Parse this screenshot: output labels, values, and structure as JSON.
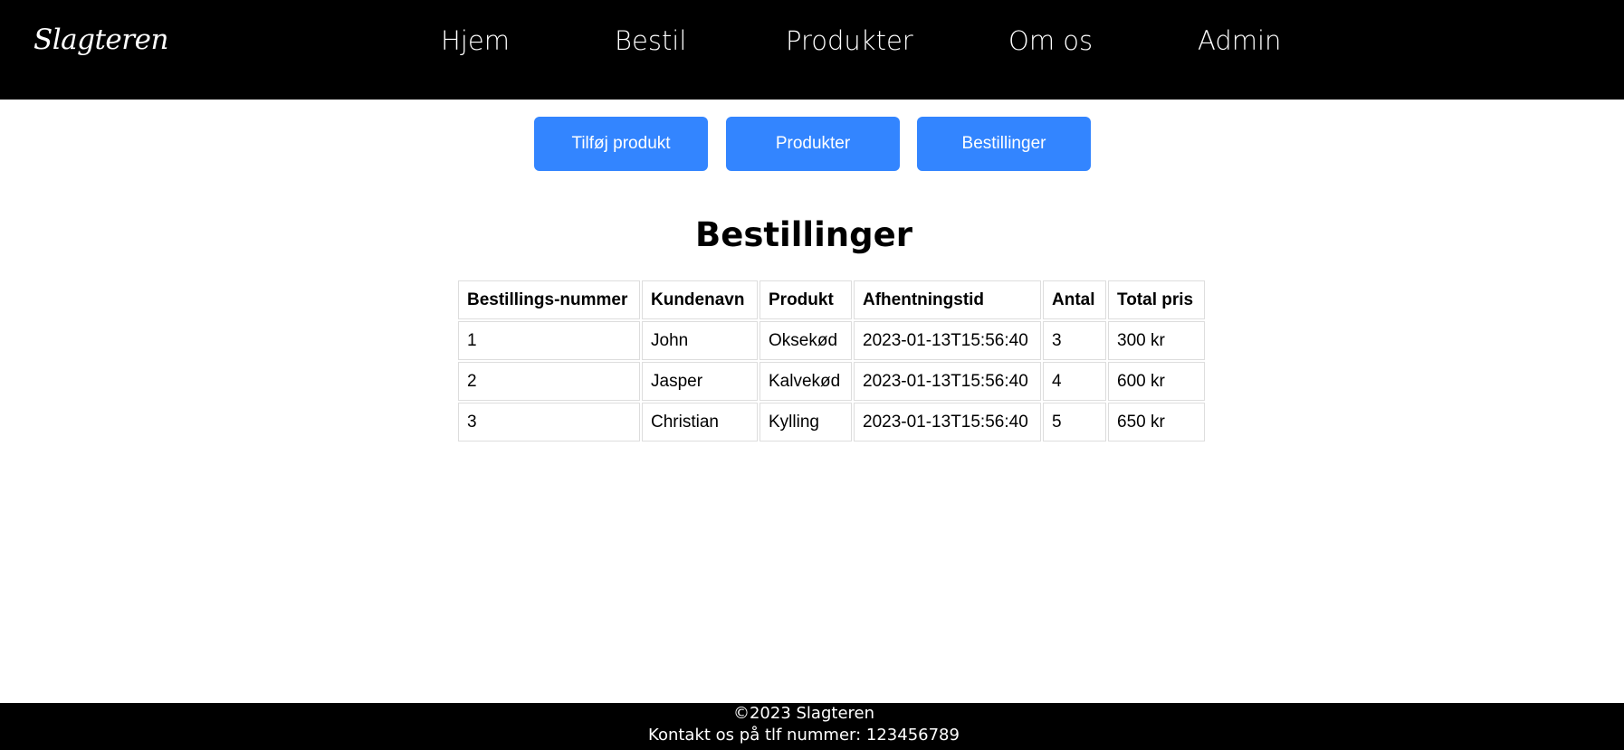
{
  "header": {
    "logo": "Slagteren",
    "nav": [
      {
        "id": "hjem",
        "label": "Hjem"
      },
      {
        "id": "bestil",
        "label": "Bestil"
      },
      {
        "id": "produkter",
        "label": "Produkter"
      },
      {
        "id": "omos",
        "label": "Om os"
      },
      {
        "id": "admin",
        "label": "Admin"
      }
    ]
  },
  "admin_buttons": {
    "add_product": "Tilføj produkt",
    "products": "Produkter",
    "orders": "Bestillinger"
  },
  "orders": {
    "title": "Bestillinger",
    "columns": [
      "Bestillings-nummer",
      "Kundenavn",
      "Produkt",
      "Afhentningstid",
      "Antal",
      "Total pris"
    ],
    "rows": [
      [
        "1",
        "John",
        "Oksekød",
        "2023-01-13T15:56:40",
        "3",
        "300 kr"
      ],
      [
        "2",
        "Jasper",
        "Kalvekød",
        "2023-01-13T15:56:40",
        "4",
        "600 kr"
      ],
      [
        "3",
        "Christian",
        "Kylling",
        "2023-01-13T15:56:40",
        "5",
        "650 kr"
      ]
    ]
  },
  "footer": {
    "copyright": "©2023 Slagteren",
    "contact": "Kontakt os på tlf nummer: 123456789"
  },
  "colors": {
    "nav_background": "#000000",
    "button_background": "#3385ff",
    "table_border": "#dddddd"
  }
}
